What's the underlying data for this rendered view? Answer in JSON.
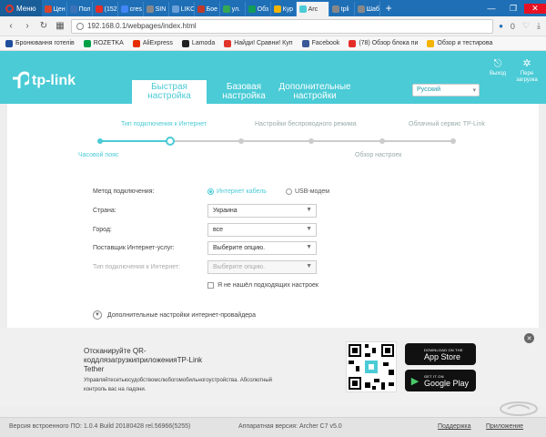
{
  "browser": {
    "menu_label": "Меню",
    "tabs": [
      {
        "label": "Цен",
        "color": "#d9442d"
      },
      {
        "label": "Пол",
        "color": "#3b73b9"
      },
      {
        "label": "(152",
        "color": "#e52d27"
      },
      {
        "label": "cres",
        "color": "#4285f4"
      },
      {
        "label": "SIN",
        "color": "#888888"
      },
      {
        "label": "LIKO",
        "color": "#6aa0d8"
      },
      {
        "label": "Бое",
        "color": "#c0392b"
      },
      {
        "label": "ул.",
        "color": "#34a853"
      },
      {
        "label": "Обз",
        "color": "#0f9d58"
      },
      {
        "label": "Кур",
        "color": "#f4b400"
      },
      {
        "label": "Arc",
        "color": "#4acbd6",
        "active": true
      },
      {
        "label": "tpli",
        "color": "#888888"
      },
      {
        "label": "Шаб",
        "color": "#888888"
      }
    ],
    "url": "192.168.0.1/webpages/index.html",
    "counter": "0",
    "bookmarks": [
      {
        "label": "Бронювання готелів",
        "color": "#1f4e9d"
      },
      {
        "label": "ROZETKA",
        "color": "#00a046"
      },
      {
        "label": "AliExpress",
        "color": "#e62e04"
      },
      {
        "label": "Lamoda",
        "color": "#222222"
      },
      {
        "label": "Найди! Сравни! Куп",
        "color": "#e2332a"
      },
      {
        "label": "Facebook",
        "color": "#3b5998"
      },
      {
        "label": "(78) Обзор блока пи",
        "color": "#e52d27"
      },
      {
        "label": "Обзор и тестирова",
        "color": "#f4b400"
      }
    ]
  },
  "router": {
    "logo_text": "tp-link",
    "tabs": [
      {
        "label": "Быстрая настройка",
        "active": true
      },
      {
        "label": "Базовая настройка"
      },
      {
        "label": "Дополнительные настройки"
      }
    ],
    "language": "Русский",
    "logout_label": "Выход",
    "reboot_label": "Пере загрузка",
    "steps_top": [
      "Тип подключения к Интернет",
      "Настройки беспроводного режима",
      "Облачный сервис TP-Link"
    ],
    "steps_bottom": [
      "Часовой пояс",
      "Обзор настроек"
    ],
    "progress_percent": 19.6,
    "form": {
      "method_label": "Метод подключения:",
      "method_cable": "Интернет кабель",
      "method_usb": "USB-модем",
      "country_label": "Страна:",
      "country_value": "Украина",
      "city_label": "Город:",
      "city_value": "все",
      "isp_label": "Поставщик Интернет-услуг:",
      "isp_value": "Выберите опцию.",
      "conn_type_label": "Тип подключения к Интернет:",
      "conn_type_value": "Выберите опцию.",
      "not_found_label": "Я не нашёл подходящих настроек",
      "advanced_label": "Дополнительные настройки интернет-провайдера"
    },
    "promo": {
      "title": "Отсканируйте QR-коддлязагрузкиприложенияTP-Link Tether",
      "desc": "Управляйтесетьюсудобствомслюбогомобильногоустройства. Абсолютный контроль вас на ладони.",
      "appstore_small": "DOWNLOAD ON THE",
      "appstore_big": "App Store",
      "gplay_small": "GET IT ON",
      "gplay_big": "Google Play"
    },
    "footer": {
      "firmware": "Версия встроенного ПО: 1.0.4 Build 20180428 rel.56966(5255)",
      "hardware": "Аппаратная версия: Archer C7 v5.0",
      "support": "Поддержка",
      "app": "Приложение"
    }
  }
}
